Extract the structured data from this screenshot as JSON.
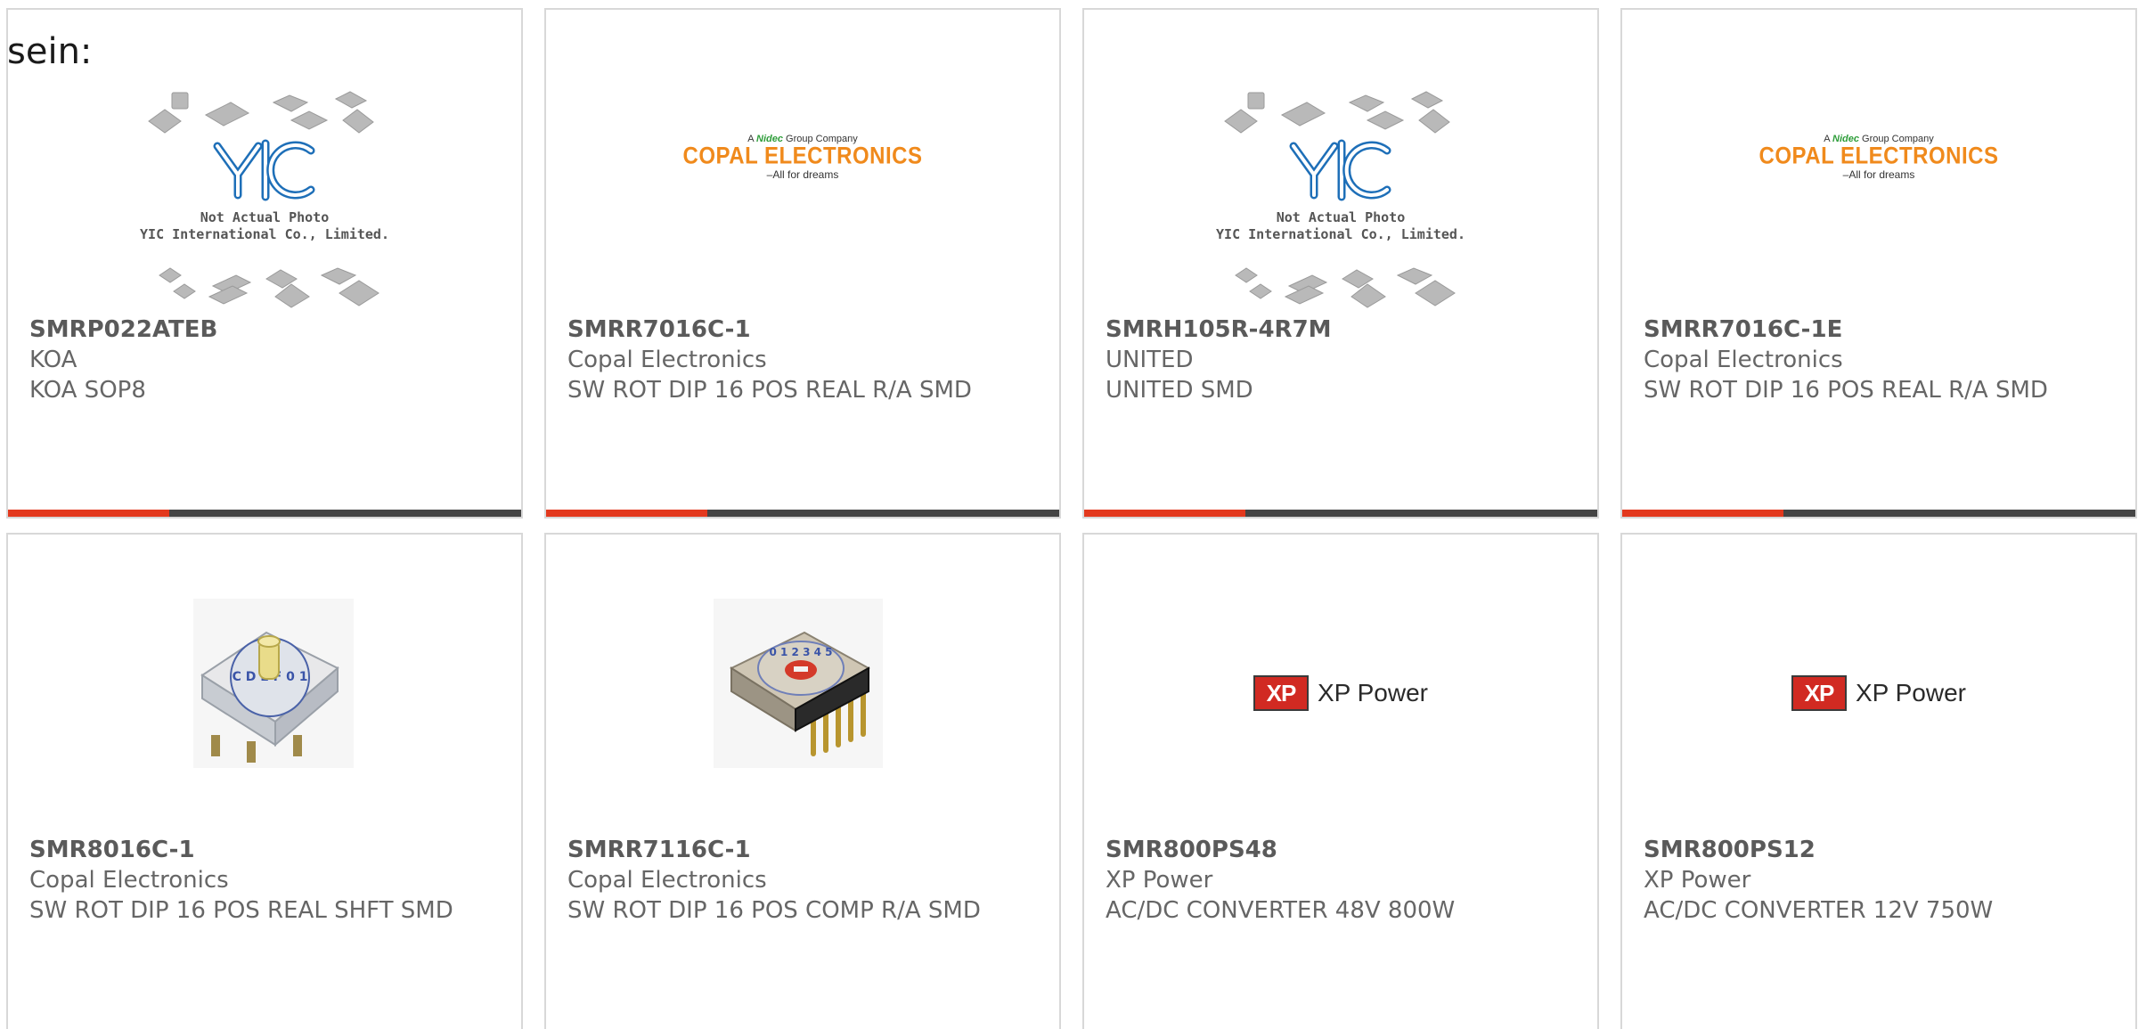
{
  "intro_text": "sein:",
  "colors": {
    "accent": "#e3391e",
    "bar": "#454545",
    "border": "#d8d8d8",
    "text": "#666666"
  },
  "yic_placeholder": {
    "line1": "Not Actual Photo",
    "line2": "YIC International Co., Limited."
  },
  "copal_logo": {
    "tag_prefix": "A",
    "tag_brand": "Nidec",
    "tag_suffix": "Group Company",
    "name": "COPAL ELECTRONICS",
    "slogan": "–All for dreams"
  },
  "xp_logo": {
    "box": "XP",
    "name": "XP Power"
  },
  "products": [
    {
      "part_number": "SMRP022ATEB",
      "manufacturer": "KOA",
      "description": "KOA SOP8",
      "image": "yic-placeholder"
    },
    {
      "part_number": "SMRR7016C-1",
      "manufacturer": "Copal Electronics",
      "description": "SW ROT DIP 16 POS REAL R/A SMD",
      "image": "copal-logo"
    },
    {
      "part_number": "SMRH105R-4R7M",
      "manufacturer": "UNITED",
      "description": "UNITED SMD",
      "image": "yic-placeholder"
    },
    {
      "part_number": "SMRR7016C-1E",
      "manufacturer": "Copal Electronics",
      "description": "SW ROT DIP 16 POS REAL R/A SMD",
      "image": "copal-logo"
    },
    {
      "part_number": "SMR8016C-1",
      "manufacturer": "Copal Electronics",
      "description": "SW ROT DIP 16 POS REAL SHFT SMD",
      "image": "rotary-switch-photo"
    },
    {
      "part_number": "SMRR7116C-1",
      "manufacturer": "Copal Electronics",
      "description": "SW ROT DIP 16 POS COMP R/A SMD",
      "image": "rotary-switch-ra-photo"
    },
    {
      "part_number": "SMR800PS48",
      "manufacturer": "XP Power",
      "description": "AC/DC CONVERTER 48V 800W",
      "image": "xp-power-logo"
    },
    {
      "part_number": "SMR800PS12",
      "manufacturer": "XP Power",
      "description": "AC/DC CONVERTER 12V 750W",
      "image": "xp-power-logo"
    }
  ]
}
